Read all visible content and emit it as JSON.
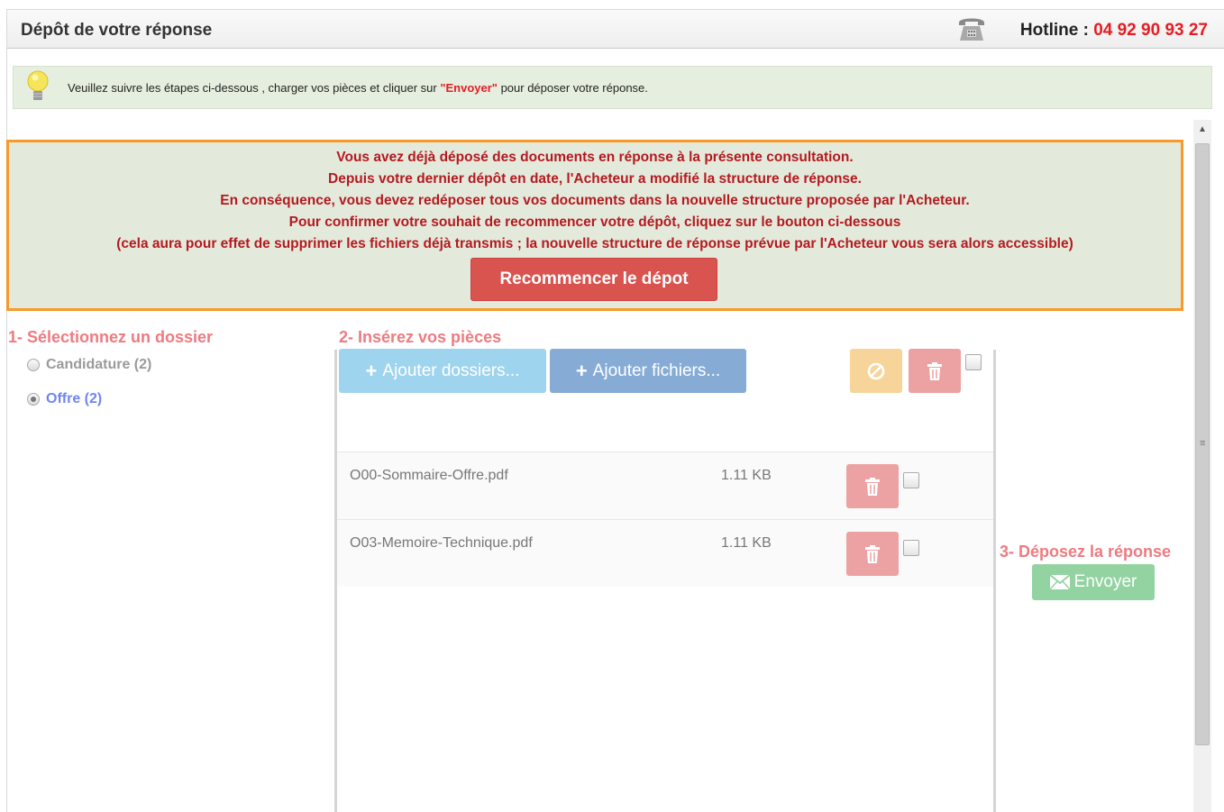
{
  "header": {
    "title": "Dépôt de votre réponse",
    "hotline_label": "Hotline : ",
    "hotline_number": "04 92 90 93 27"
  },
  "hint": {
    "text_before": "Veuillez suivre les étapes ci-dessous , charger vos pièces et cliquer sur ",
    "emphasis": "\"Envoyer\"",
    "text_after": " pour déposer votre réponse."
  },
  "warning": {
    "lines": [
      "Vous avez déjà déposé des documents en réponse à la présente consultation.",
      "Depuis votre dernier dépôt en date, l'Acheteur a modifié la structure de réponse.",
      "En conséquence, vous devez redéposer tous vos documents dans la nouvelle structure proposée par l'Acheteur.",
      "Pour confirmer votre souhait de recommencer votre dépôt, cliquez sur le bouton ci-dessous",
      "(cela aura pour effet de supprimer les fichiers déjà transmis ; la nouvelle structure de réponse prévue par l'Acheteur vous sera alors accessible)"
    ],
    "button_label": "Recommencer le dépot"
  },
  "step1": {
    "title": "1- Sélectionnez un dossier",
    "options": [
      {
        "label": "Candidature (2)",
        "selected": false
      },
      {
        "label": "Offre (2)",
        "selected": true
      }
    ]
  },
  "step2": {
    "title": "2- Insérez vos pièces",
    "add_folders_label": "Ajouter dossiers...",
    "add_files_label": "Ajouter fichiers...",
    "files": [
      {
        "name": "O00-Sommaire-Offre.pdf",
        "size": "1.11 KB"
      },
      {
        "name": "O03-Memoire-Technique.pdf",
        "size": "1.11 KB"
      }
    ]
  },
  "step3": {
    "title": "3- Déposez la réponse",
    "send_label": "Envoyer"
  },
  "colors": {
    "accent_red": "#e51c23",
    "step_title": "#ef7a80",
    "warning_border": "#f79a2a",
    "warning_bg": "#e3eadc",
    "restart_button": "#d9534f"
  }
}
